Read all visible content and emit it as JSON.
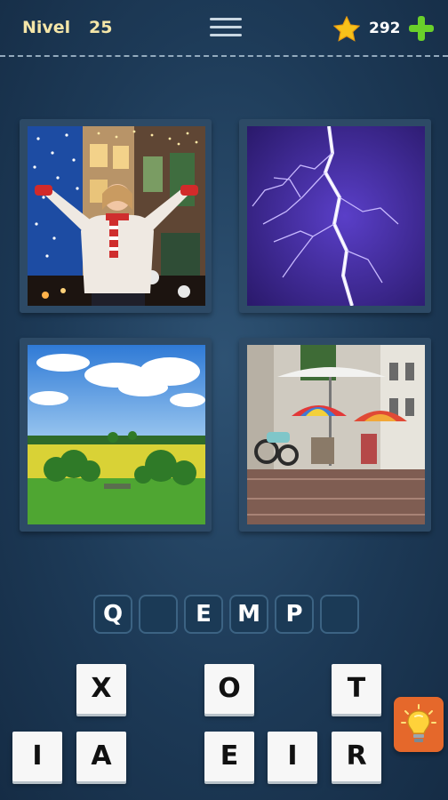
{
  "header": {
    "level_label": "Nivel",
    "level_number": "25",
    "coins": "292"
  },
  "icons": {
    "menu": "hamburger-menu-icon",
    "star": "star-icon",
    "plus": "plus-icon",
    "hint": "lightbulb-icon"
  },
  "puzzle_images": [
    {
      "subject": "woman-in-snow-with-lights"
    },
    {
      "subject": "lightning-bolt-storm"
    },
    {
      "subject": "green-field-blue-sky"
    },
    {
      "subject": "rainy-street-cafe-umbrellas"
    }
  ],
  "answer_slots": [
    "Q",
    "",
    "E",
    "M",
    "P",
    ""
  ],
  "letter_keys_row1": [
    "X",
    "",
    "O",
    "",
    "T"
  ],
  "letter_keys_row2": [
    "I",
    "A",
    "",
    "E",
    "I",
    "R"
  ],
  "colors": {
    "background": "#1d3a57",
    "level_text": "#f5e6a8",
    "plus_green": "#6ad02a",
    "star_yellow": "#f7c21a",
    "hint_button": "#e5682b"
  }
}
